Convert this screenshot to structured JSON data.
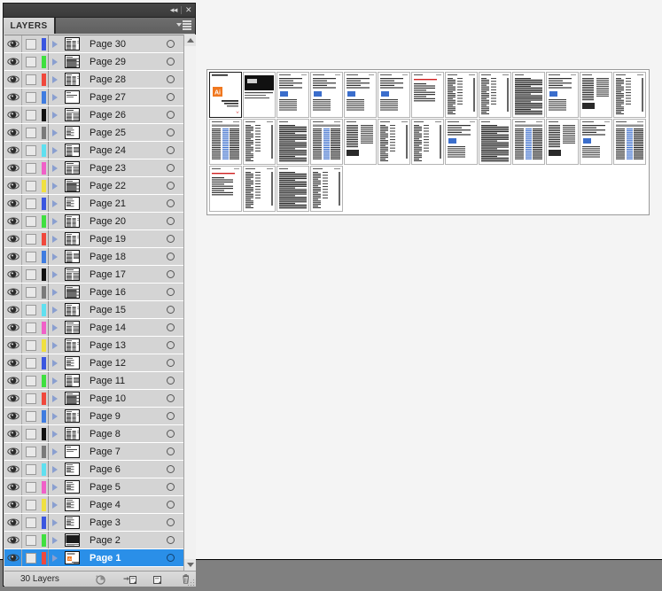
{
  "window": {
    "title_bar": {
      "collapse_label": "◂◂",
      "close_label": "✕"
    }
  },
  "panel": {
    "tab_label": "LAYERS",
    "menu_icon": "panel-menu-icon",
    "footer": {
      "layer_count": "30 Layers",
      "buttons": [
        {
          "name": "make-clipping-mask-button",
          "icon": "clipping-mask-icon"
        },
        {
          "name": "create-new-sublayer-button",
          "icon": "new-sublayer-icon"
        },
        {
          "name": "create-new-layer-button",
          "icon": "new-layer-icon"
        },
        {
          "name": "delete-selection-button",
          "icon": "trash-icon"
        }
      ]
    },
    "scrollbar": {
      "up_arrow": "scroll-up-arrow",
      "down_arrow": "scroll-down-arrow"
    },
    "colors": {
      "selection_blue": "#2a8fe8",
      "row_background": "#d4d4d4",
      "panel_background": "#d4d4d4",
      "titlebar": "#3d3d3d"
    },
    "layers": [
      {
        "name": "Page 30",
        "color": "#3a56e0",
        "visible": true,
        "locked": false,
        "selected": false,
        "expanded": false,
        "thumb": "dense-columns"
      },
      {
        "name": "Page 29",
        "color": "#3fe03f",
        "visible": true,
        "locked": false,
        "selected": false,
        "expanded": false,
        "thumb": "dense-text"
      },
      {
        "name": "Page 28",
        "color": "#f0483c",
        "visible": true,
        "locked": false,
        "selected": false,
        "expanded": false,
        "thumb": "dense-columns"
      },
      {
        "name": "Page 27",
        "color": "#3f7ce0",
        "visible": true,
        "locked": false,
        "selected": false,
        "expanded": false,
        "thumb": "sparse-top"
      },
      {
        "name": "Page 26",
        "color": "#111111",
        "visible": true,
        "locked": false,
        "selected": false,
        "expanded": false,
        "thumb": "table"
      },
      {
        "name": "Page 25",
        "color": "#7a7a7a",
        "visible": true,
        "locked": false,
        "selected": false,
        "expanded": false,
        "thumb": "sparse-left"
      },
      {
        "name": "Page 24",
        "color": "#5fe0f0",
        "visible": true,
        "locked": false,
        "selected": false,
        "expanded": false,
        "thumb": "two-col"
      },
      {
        "name": "Page 23",
        "color": "#f060c8",
        "visible": true,
        "locked": false,
        "selected": false,
        "expanded": false,
        "thumb": "table"
      },
      {
        "name": "Page 22",
        "color": "#f0e040",
        "visible": true,
        "locked": false,
        "selected": false,
        "expanded": false,
        "thumb": "dense-text"
      },
      {
        "name": "Page 21",
        "color": "#3a56e0",
        "visible": true,
        "locked": false,
        "selected": false,
        "expanded": false,
        "thumb": "sparse-left"
      },
      {
        "name": "Page 20",
        "color": "#3fe03f",
        "visible": true,
        "locked": false,
        "selected": false,
        "expanded": false,
        "thumb": "dense-columns"
      },
      {
        "name": "Page 19",
        "color": "#f0483c",
        "visible": true,
        "locked": false,
        "selected": false,
        "expanded": false,
        "thumb": "dense-columns"
      },
      {
        "name": "Page 18",
        "color": "#3f7ce0",
        "visible": true,
        "locked": false,
        "selected": false,
        "expanded": false,
        "thumb": "two-col"
      },
      {
        "name": "Page 17",
        "color": "#111111",
        "visible": true,
        "locked": false,
        "selected": false,
        "expanded": false,
        "thumb": "table"
      },
      {
        "name": "Page 16",
        "color": "#7a7a7a",
        "visible": true,
        "locked": false,
        "selected": false,
        "expanded": false,
        "thumb": "dense-text"
      },
      {
        "name": "Page 15",
        "color": "#5fe0f0",
        "visible": true,
        "locked": false,
        "selected": false,
        "expanded": false,
        "thumb": "dense-columns"
      },
      {
        "name": "Page 14",
        "color": "#f060c8",
        "visible": true,
        "locked": false,
        "selected": false,
        "expanded": false,
        "thumb": "table"
      },
      {
        "name": "Page 13",
        "color": "#f0e040",
        "visible": true,
        "locked": false,
        "selected": false,
        "expanded": false,
        "thumb": "dense-columns"
      },
      {
        "name": "Page 12",
        "color": "#3a56e0",
        "visible": true,
        "locked": false,
        "selected": false,
        "expanded": false,
        "thumb": "sparse-left"
      },
      {
        "name": "Page 11",
        "color": "#3fe03f",
        "visible": true,
        "locked": false,
        "selected": false,
        "expanded": false,
        "thumb": "two-col"
      },
      {
        "name": "Page 10",
        "color": "#f0483c",
        "visible": true,
        "locked": false,
        "selected": false,
        "expanded": false,
        "thumb": "dense-text"
      },
      {
        "name": "Page 9",
        "color": "#3f7ce0",
        "visible": true,
        "locked": false,
        "selected": false,
        "expanded": false,
        "thumb": "dense-columns"
      },
      {
        "name": "Page 8",
        "color": "#111111",
        "visible": true,
        "locked": false,
        "selected": false,
        "expanded": false,
        "thumb": "dense-columns"
      },
      {
        "name": "Page 7",
        "color": "#7a7a7a",
        "visible": true,
        "locked": false,
        "selected": false,
        "expanded": false,
        "thumb": "sparse-top"
      },
      {
        "name": "Page 6",
        "color": "#5fe0f0",
        "visible": true,
        "locked": false,
        "selected": false,
        "expanded": false,
        "thumb": "sparse-left"
      },
      {
        "name": "Page 5",
        "color": "#f060c8",
        "visible": true,
        "locked": false,
        "selected": false,
        "expanded": false,
        "thumb": "sparse-left"
      },
      {
        "name": "Page 4",
        "color": "#f0e040",
        "visible": true,
        "locked": false,
        "selected": false,
        "expanded": false,
        "thumb": "sparse-left"
      },
      {
        "name": "Page 3",
        "color": "#3a56e0",
        "visible": true,
        "locked": false,
        "selected": false,
        "expanded": false,
        "thumb": "sparse-left"
      },
      {
        "name": "Page 2",
        "color": "#3fe03f",
        "visible": true,
        "locked": false,
        "selected": false,
        "expanded": false,
        "thumb": "dark-image"
      },
      {
        "name": "Page 1",
        "color": "#f0483c",
        "visible": true,
        "locked": false,
        "selected": true,
        "expanded": false,
        "thumb": "cover"
      }
    ]
  },
  "document": {
    "thumbnail_count": 30,
    "rows": [
      13,
      13,
      4
    ],
    "pages": [
      {
        "index": 1,
        "type": "cover"
      },
      {
        "index": 2,
        "type": "dark-image"
      },
      {
        "index": 3,
        "type": "sparse-left"
      },
      {
        "index": 4,
        "type": "sparse-left"
      },
      {
        "index": 5,
        "type": "sparse-left"
      },
      {
        "index": 6,
        "type": "sparse-left"
      },
      {
        "index": 7,
        "type": "sparse-top"
      },
      {
        "index": 8,
        "type": "dense-columns"
      },
      {
        "index": 9,
        "type": "dense-columns"
      },
      {
        "index": 10,
        "type": "dense-text"
      },
      {
        "index": 11,
        "type": "sparse-left"
      },
      {
        "index": 12,
        "type": "two-col"
      },
      {
        "index": 13,
        "type": "dense-columns"
      },
      {
        "index": 14,
        "type": "table"
      },
      {
        "index": 15,
        "type": "dense-columns"
      },
      {
        "index": 16,
        "type": "dense-text"
      },
      {
        "index": 17,
        "type": "table"
      },
      {
        "index": 18,
        "type": "two-col"
      },
      {
        "index": 19,
        "type": "dense-columns"
      },
      {
        "index": 20,
        "type": "dense-columns"
      },
      {
        "index": 21,
        "type": "sparse-left"
      },
      {
        "index": 22,
        "type": "dense-text"
      },
      {
        "index": 23,
        "type": "table"
      },
      {
        "index": 24,
        "type": "two-col"
      },
      {
        "index": 25,
        "type": "sparse-left"
      },
      {
        "index": 26,
        "type": "table"
      },
      {
        "index": 27,
        "type": "sparse-top"
      },
      {
        "index": 28,
        "type": "dense-columns"
      },
      {
        "index": 29,
        "type": "dense-text"
      },
      {
        "index": 30,
        "type": "dense-columns"
      }
    ],
    "cover": {
      "logo_label": "Ai",
      "logo_color": "#f07820"
    }
  }
}
